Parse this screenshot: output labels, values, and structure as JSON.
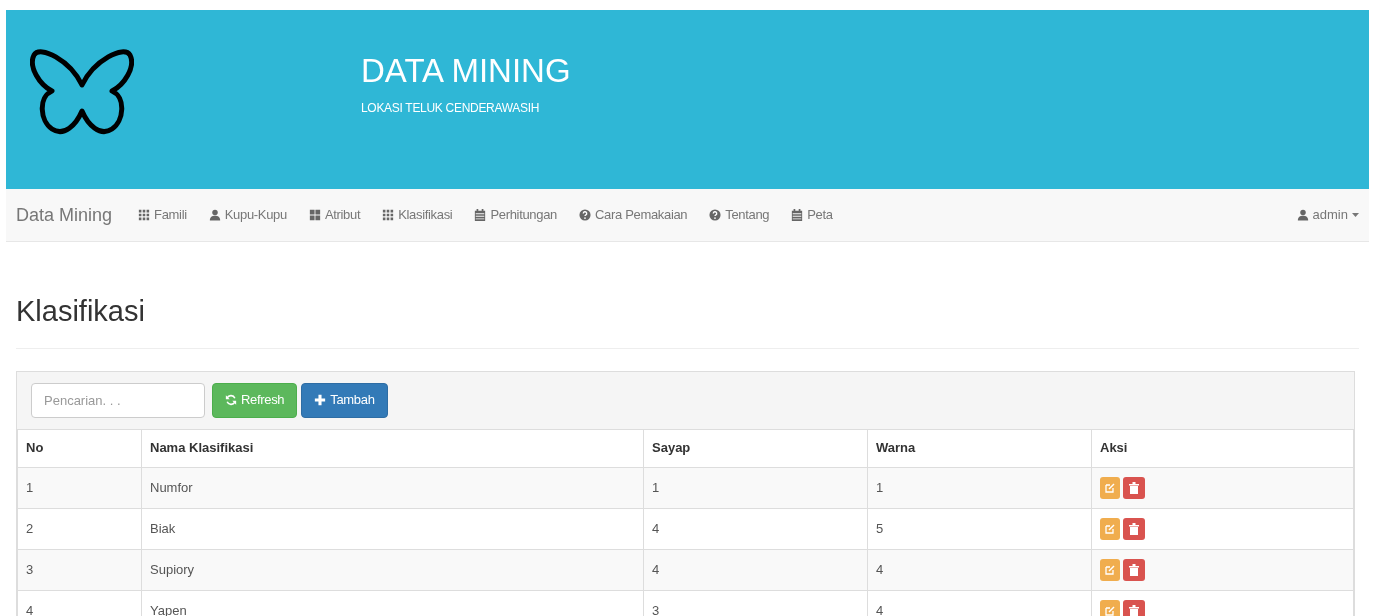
{
  "header": {
    "title": "DATA MINING",
    "subtitle": "LOKASI TELUK CENDERAWASIH"
  },
  "navbar": {
    "brand": "Data Mining",
    "items": [
      {
        "label": "Famili",
        "kind": "grid"
      },
      {
        "label": "Kupu-Kupu",
        "kind": "user"
      },
      {
        "label": "Atribut",
        "kind": "tiles"
      },
      {
        "label": "Klasifikasi",
        "kind": "grid"
      },
      {
        "label": "Perhitungan",
        "kind": "calendar"
      },
      {
        "label": "Cara Pemakaian",
        "kind": "help"
      },
      {
        "label": "Tentang",
        "kind": "help"
      },
      {
        "label": "Peta",
        "kind": "calendar"
      }
    ],
    "user": "admin"
  },
  "page_title": "Klasifikasi",
  "toolbar": {
    "search": {
      "placeholder": "Pencarian. . ."
    },
    "buttons": [
      {
        "label": "Refresh",
        "kind": "refresh"
      },
      {
        "label": "Tambah",
        "kind": "add"
      }
    ]
  },
  "table": {
    "columns": [
      "No",
      "Nama Klasifikasi",
      "Sayap",
      "Warna",
      "Aksi"
    ],
    "rows": [
      [
        "1",
        "Numfor",
        "1",
        "1"
      ],
      [
        "2",
        "Biak",
        "4",
        "5"
      ],
      [
        "3",
        "Supiory",
        "4",
        "4"
      ],
      [
        "4",
        "Yapen",
        "3",
        "4"
      ]
    ]
  }
}
